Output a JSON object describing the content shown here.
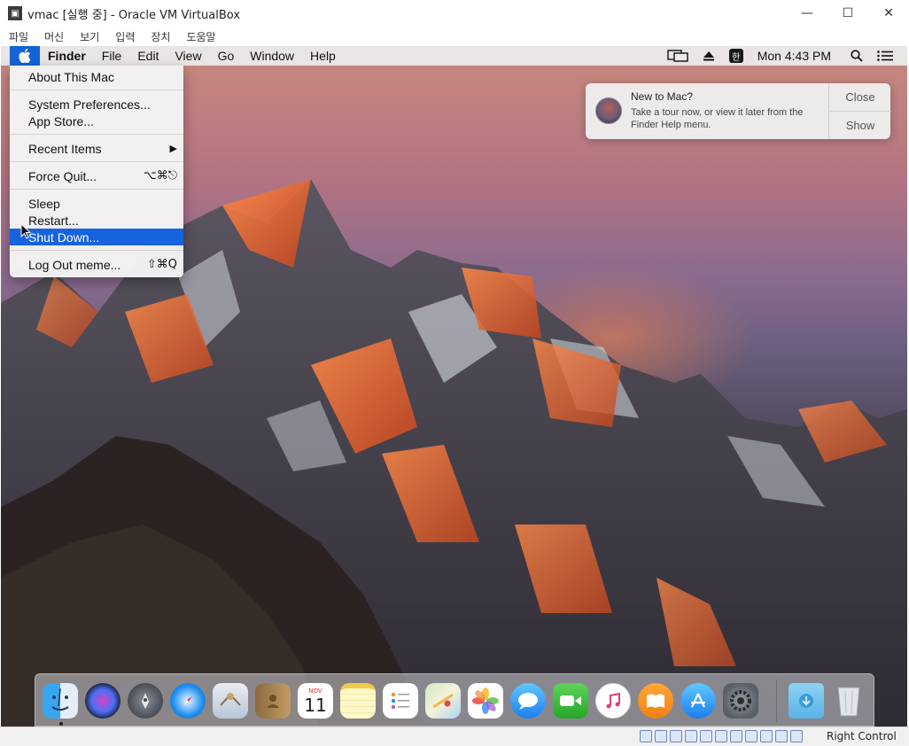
{
  "window": {
    "title": "vmac [실행 중] - Oracle VM VirtualBox",
    "minimize": "—",
    "maximize": "☐",
    "close": "✕"
  },
  "vbox_menu": [
    "파일",
    "머신",
    "보기",
    "입력",
    "장치",
    "도움말"
  ],
  "mac_menu": {
    "app_name": "Finder",
    "items": [
      "File",
      "Edit",
      "View",
      "Go",
      "Window",
      "Help"
    ]
  },
  "mac_status": {
    "input_source": "한",
    "clock": "Mon 4:43 PM"
  },
  "apple_menu": {
    "about": "About This Mac",
    "system_prefs": "System Preferences...",
    "app_store": "App Store...",
    "recent_items": "Recent Items",
    "recent_arrow": "▶",
    "force_quit": "Force Quit...",
    "force_quit_shortcut": "⌥⌘⎋",
    "sleep": "Sleep",
    "restart": "Restart...",
    "shut_down": "Shut Down...",
    "log_out": "Log Out meme...",
    "log_out_shortcut": "⇧⌘Q",
    "selected_item": "Shut Down..."
  },
  "notification": {
    "title": "New to Mac?",
    "body": "Take a tour now, or view it later from the Finder Help menu.",
    "close_label": "Close",
    "show_label": "Show"
  },
  "calendar_icon": {
    "month": "NOV",
    "day": "11"
  },
  "dock_icons": [
    "finder-icon",
    "siri-icon",
    "launchpad-icon",
    "safari-icon",
    "mail-icon",
    "contacts-icon",
    "calendar-icon",
    "notes-icon",
    "reminders-icon",
    "maps-icon",
    "photos-icon",
    "messages-icon",
    "facetime-icon",
    "itunes-icon",
    "ibooks-icon",
    "app-store-icon",
    "system-preferences-icon",
    "downloads-folder-icon",
    "trash-icon"
  ],
  "status_bar": {
    "host_key": "Right Control"
  },
  "colors": {
    "selection_blue": "#1663dd",
    "apple_menu_blue": "#1563d8"
  }
}
